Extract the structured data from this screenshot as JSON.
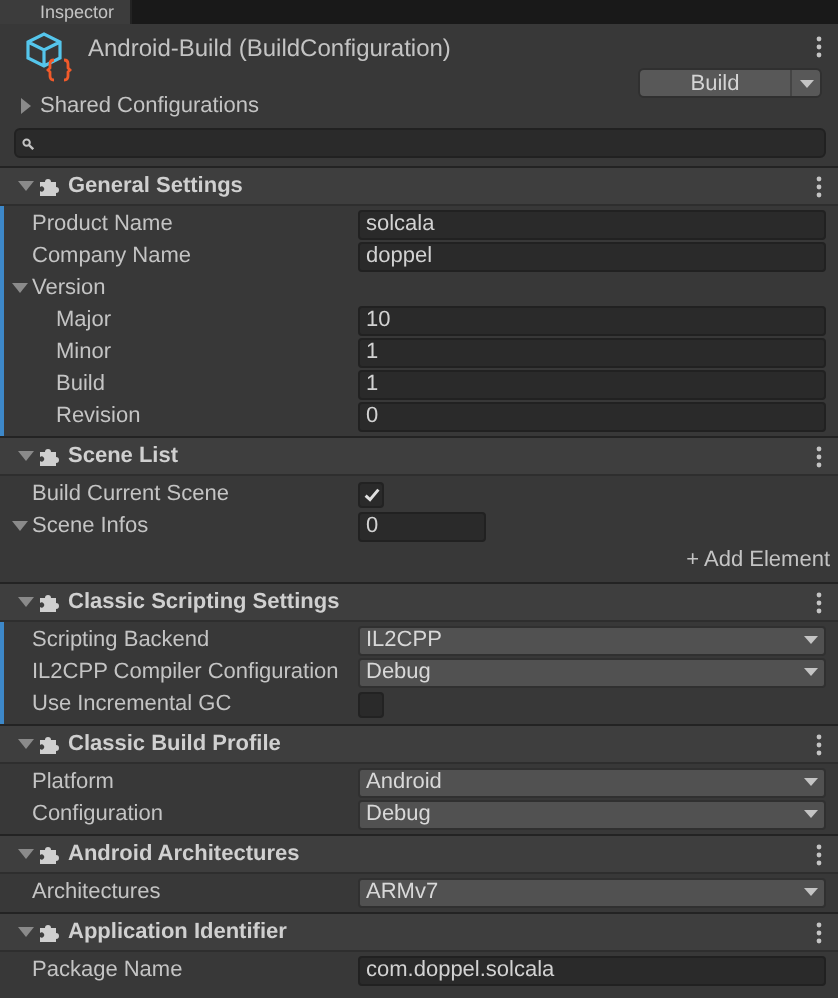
{
  "tab": {
    "label": "Inspector"
  },
  "header": {
    "title": "Android-Build (BuildConfiguration)",
    "build_button": "Build",
    "shared": {
      "label": "Shared Configurations",
      "expanded": false
    }
  },
  "sections": [
    {
      "title": "General Settings",
      "expanded": true,
      "modified": true,
      "rows": [
        {
          "kind": "field",
          "label": "Product Name",
          "value": "solcala"
        },
        {
          "kind": "field",
          "label": "Company Name",
          "value": "doppel"
        },
        {
          "kind": "foldout",
          "label": "Version",
          "expanded": true,
          "children": [
            {
              "kind": "field",
              "label": "Major",
              "value": "10"
            },
            {
              "kind": "field",
              "label": "Minor",
              "value": "1"
            },
            {
              "kind": "field",
              "label": "Build",
              "value": "1"
            },
            {
              "kind": "field",
              "label": "Revision",
              "value": "0"
            }
          ]
        }
      ]
    },
    {
      "title": "Scene List",
      "expanded": true,
      "modified": false,
      "rows": [
        {
          "kind": "checkbox",
          "label": "Build Current Scene",
          "checked": true
        },
        {
          "kind": "foldout",
          "label": "Scene Infos",
          "expanded": true,
          "size": "0",
          "children": []
        },
        {
          "kind": "add",
          "label": "+ Add Element"
        }
      ]
    },
    {
      "title": "Classic Scripting Settings",
      "expanded": true,
      "modified": true,
      "rows": [
        {
          "kind": "dropdown",
          "label": "Scripting Backend",
          "value": "IL2CPP"
        },
        {
          "kind": "dropdown",
          "label": "IL2CPP Compiler Configuration",
          "value": "Debug"
        },
        {
          "kind": "checkbox",
          "label": "Use Incremental GC",
          "checked": false
        }
      ]
    },
    {
      "title": "Classic Build Profile",
      "expanded": true,
      "modified": false,
      "rows": [
        {
          "kind": "dropdown",
          "label": "Platform",
          "value": "Android"
        },
        {
          "kind": "dropdown",
          "label": "Configuration",
          "value": "Debug"
        }
      ]
    },
    {
      "title": "Android Architectures",
      "expanded": true,
      "modified": false,
      "rows": [
        {
          "kind": "dropdown",
          "label": "Architectures",
          "value": "ARMv7"
        }
      ]
    },
    {
      "title": "Application Identifier",
      "expanded": true,
      "modified": false,
      "rows": [
        {
          "kind": "field",
          "label": "Package Name",
          "value": "com.doppel.solcala"
        }
      ]
    }
  ]
}
